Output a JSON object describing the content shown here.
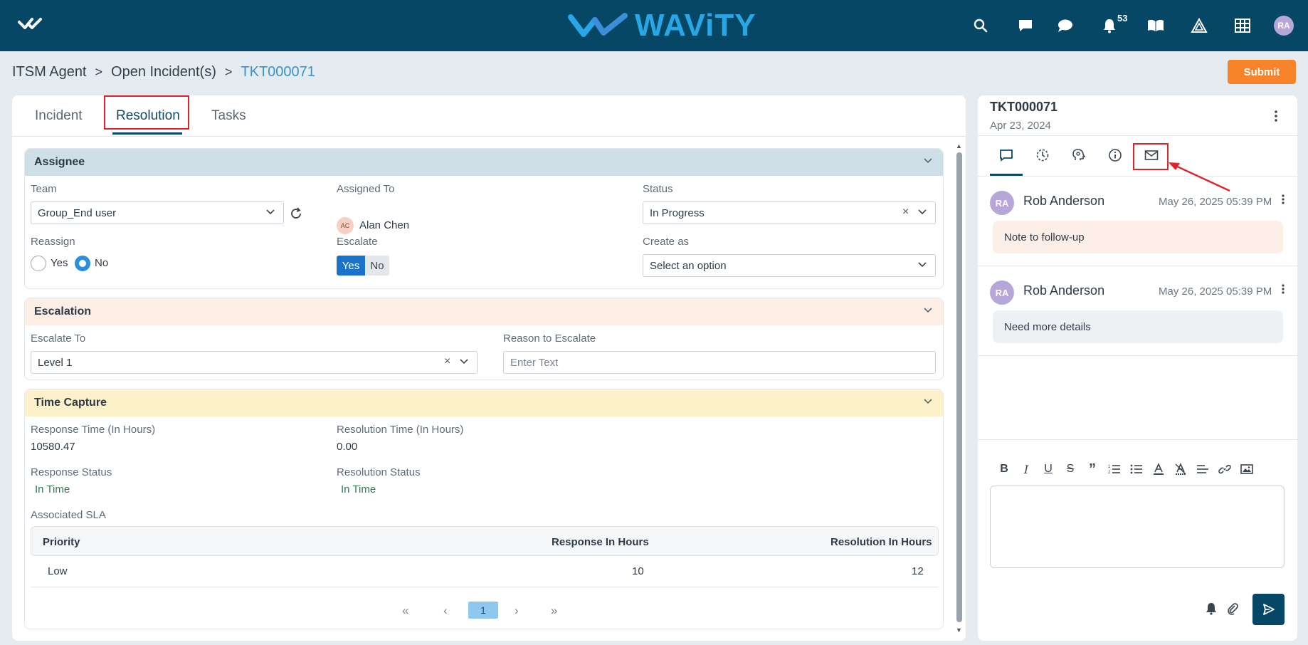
{
  "header": {
    "brand": "WAViTY",
    "notification_count": "53",
    "user_initials": "RA",
    "icons": [
      "home-check-icon",
      "search-icon",
      "chat-square-icon",
      "chat-bubble-icon",
      "bell-icon",
      "book-icon",
      "triangle-icon",
      "grid-icon"
    ]
  },
  "breadcrumb": {
    "items": [
      "ITSM Agent",
      "Open Incident(s)",
      "TKT000071"
    ],
    "separator": ">"
  },
  "actions": {
    "submit_label": "Submit"
  },
  "tabs": [
    {
      "label": "Incident"
    },
    {
      "label": "Resolution",
      "active": true
    },
    {
      "label": "Tasks"
    }
  ],
  "assignee": {
    "title": "Assignee",
    "team_label": "Team",
    "team_value": "Group_End user",
    "assigned_to_label": "Assigned To",
    "assigned_to_initials": "AC",
    "assigned_to_value": "Alan Chen",
    "status_label": "Status",
    "status_value": "In Progress",
    "reassign_label": "Reassign",
    "reassign_yes": "Yes",
    "reassign_no": "No",
    "reassign_selected": "No",
    "escalate_label": "Escalate",
    "escalate_yes": "Yes",
    "escalate_no": "No",
    "escalate_selected": "Yes",
    "create_as_label": "Create as",
    "create_as_placeholder": "Select an option"
  },
  "escalation": {
    "title": "Escalation",
    "escalate_to_label": "Escalate To",
    "escalate_to_value": "Level 1",
    "reason_label": "Reason to Escalate",
    "reason_placeholder": "Enter Text"
  },
  "time_capture": {
    "title": "Time Capture",
    "response_time_label": "Response Time (In Hours)",
    "response_time_value": "10580.47",
    "resolution_time_label": "Resolution Time (In Hours)",
    "resolution_time_value": "0.00",
    "response_status_label": "Response Status",
    "response_status_value": "In Time",
    "resolution_status_label": "Resolution Status",
    "resolution_status_value": "In Time",
    "sla_label": "Associated SLA",
    "sla_columns": [
      "Priority",
      "Response In Hours",
      "Resolution In Hours"
    ],
    "sla_rows": [
      {
        "priority": "Low",
        "response": "10",
        "resolution": "12"
      }
    ],
    "pagination": {
      "first": "«",
      "prev": "‹",
      "current": "1",
      "next": "›",
      "last": "»"
    }
  },
  "ticket_panel": {
    "ticket_id": "TKT000071",
    "date": "Apr 23, 2024",
    "notes": [
      {
        "initials": "RA",
        "author": "Rob Anderson",
        "time": "May 26, 2025 05:39 PM",
        "text": "Note to follow-up",
        "color": "#fdeee8"
      },
      {
        "initials": "RA",
        "author": "Rob Anderson",
        "time": "May 26, 2025 05:39 PM",
        "text": "Need more details",
        "color": "#eef1f4"
      }
    ]
  },
  "colors": {
    "header_bg": "#074766",
    "brand_blue": "#29a6e6",
    "submit_orange": "#f7832a",
    "assignee_header": "#cfdfe8",
    "escalation_header": "#fdeee6",
    "time_capture_header": "#fdf1c9",
    "highlight_red": "#e0222b"
  }
}
